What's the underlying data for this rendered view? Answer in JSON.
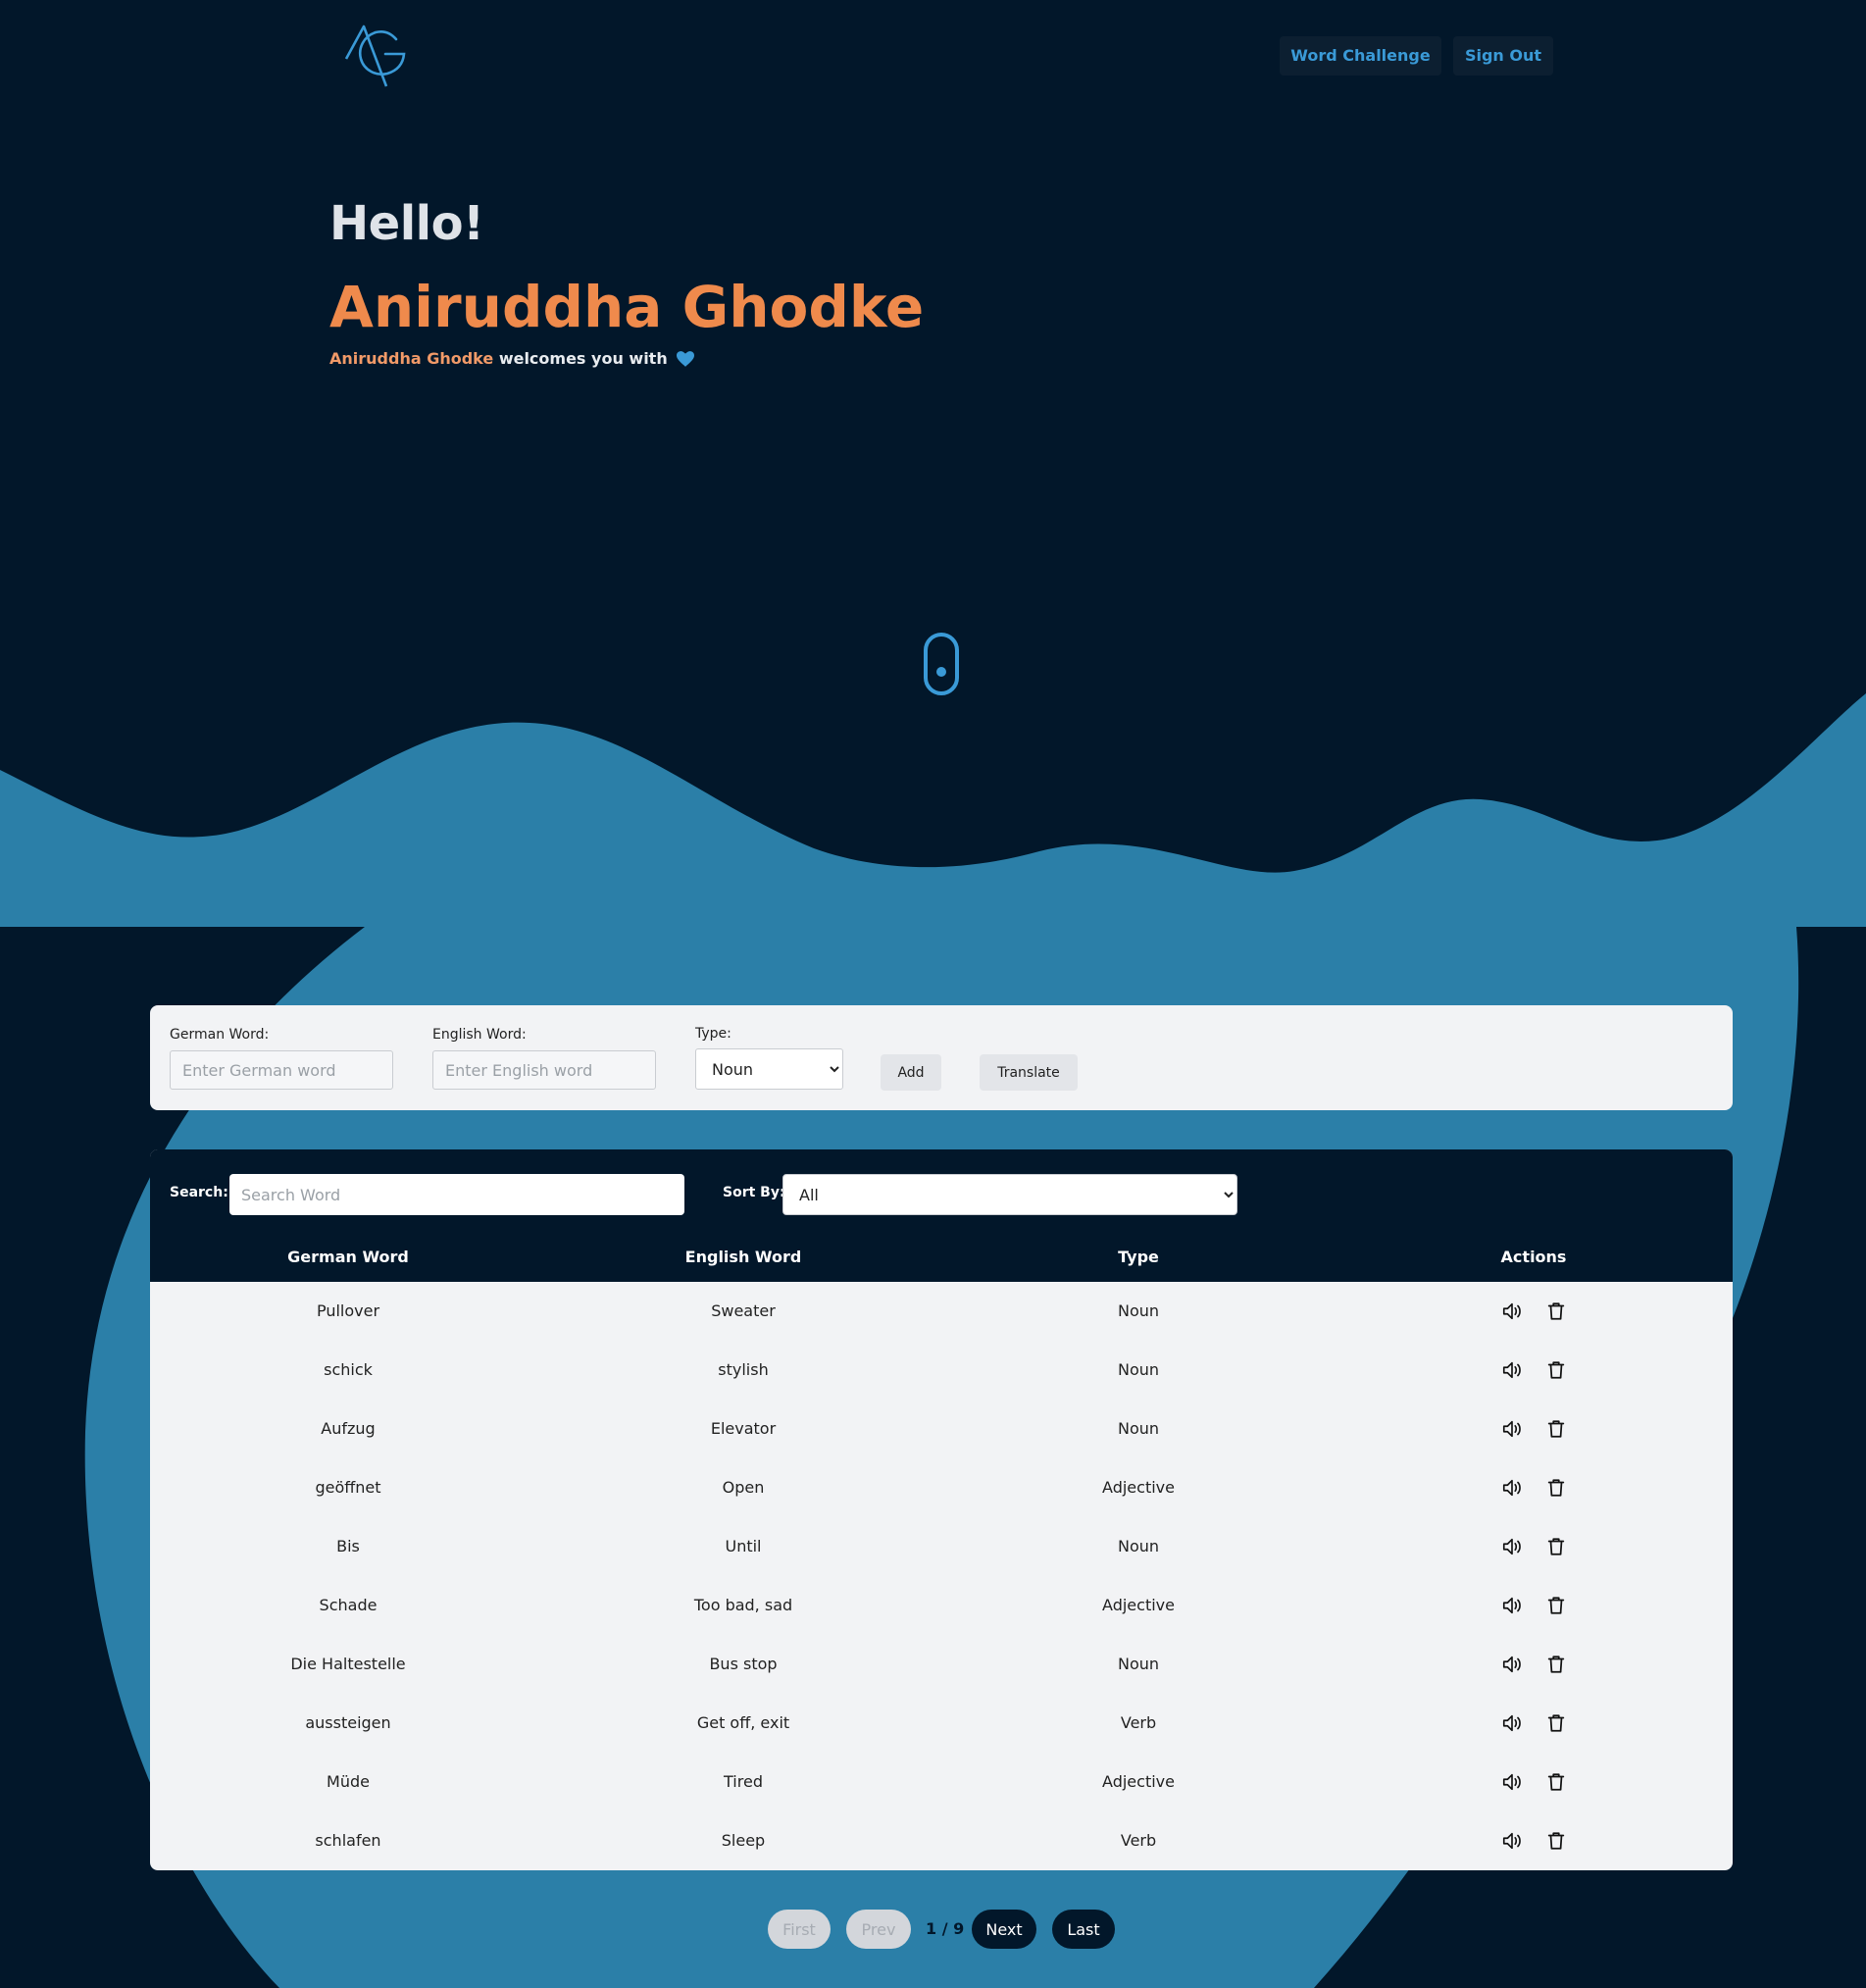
{
  "colors": {
    "background": "#02172a",
    "accent_blue": "#2b7fa8",
    "name_orange": "#ef8a4c",
    "panel": "#f2f3f5"
  },
  "header": {
    "logo_icon": "ag-monogram-logo",
    "nav": {
      "word_challenge": "Word Challenge",
      "sign_out": "Sign Out"
    }
  },
  "hero": {
    "greeting": "Hello!",
    "name": "Aniruddha Ghodke",
    "welcome_name": "Aniruddha Ghodke",
    "welcome_text": "welcomes you with",
    "heart_icon": "heart-icon",
    "scroll_icon": "mouse-scroll-icon"
  },
  "add_form": {
    "german_label": "German Word:",
    "german_placeholder": "Enter German word",
    "english_label": "English Word:",
    "english_placeholder": "Enter English word",
    "type_label": "Type:",
    "type_selected": "Noun",
    "add_button": "Add",
    "translate_button": "Translate"
  },
  "table": {
    "search_label": "Search:",
    "search_placeholder": "Search Word",
    "sort_label": "Sort By:",
    "sort_selected": "All",
    "headers": {
      "german": "German Word",
      "english": "English Word",
      "type": "Type",
      "actions": "Actions"
    },
    "rows": [
      {
        "german": "Pullover",
        "english": "Sweater",
        "type": "Noun"
      },
      {
        "german": "schick",
        "english": "stylish",
        "type": "Noun"
      },
      {
        "german": "Aufzug",
        "english": "Elevator",
        "type": "Noun"
      },
      {
        "german": "geöffnet",
        "english": "Open",
        "type": "Adjective"
      },
      {
        "german": "Bis",
        "english": "Until",
        "type": "Noun"
      },
      {
        "german": "Schade",
        "english": "Too bad, sad",
        "type": "Adjective"
      },
      {
        "german": "Die Haltestelle",
        "english": "Bus stop",
        "type": "Noun"
      },
      {
        "german": "aussteigen",
        "english": "Get off, exit",
        "type": "Verb"
      },
      {
        "german": "Müde",
        "english": "Tired",
        "type": "Adjective"
      },
      {
        "german": "schlafen",
        "english": "Sleep",
        "type": "Verb"
      }
    ],
    "action_icons": [
      "speaker-icon",
      "trash-icon"
    ]
  },
  "pagination": {
    "first": "First",
    "prev": "Prev",
    "info": "1 / 9",
    "next": "Next",
    "last": "Last"
  }
}
